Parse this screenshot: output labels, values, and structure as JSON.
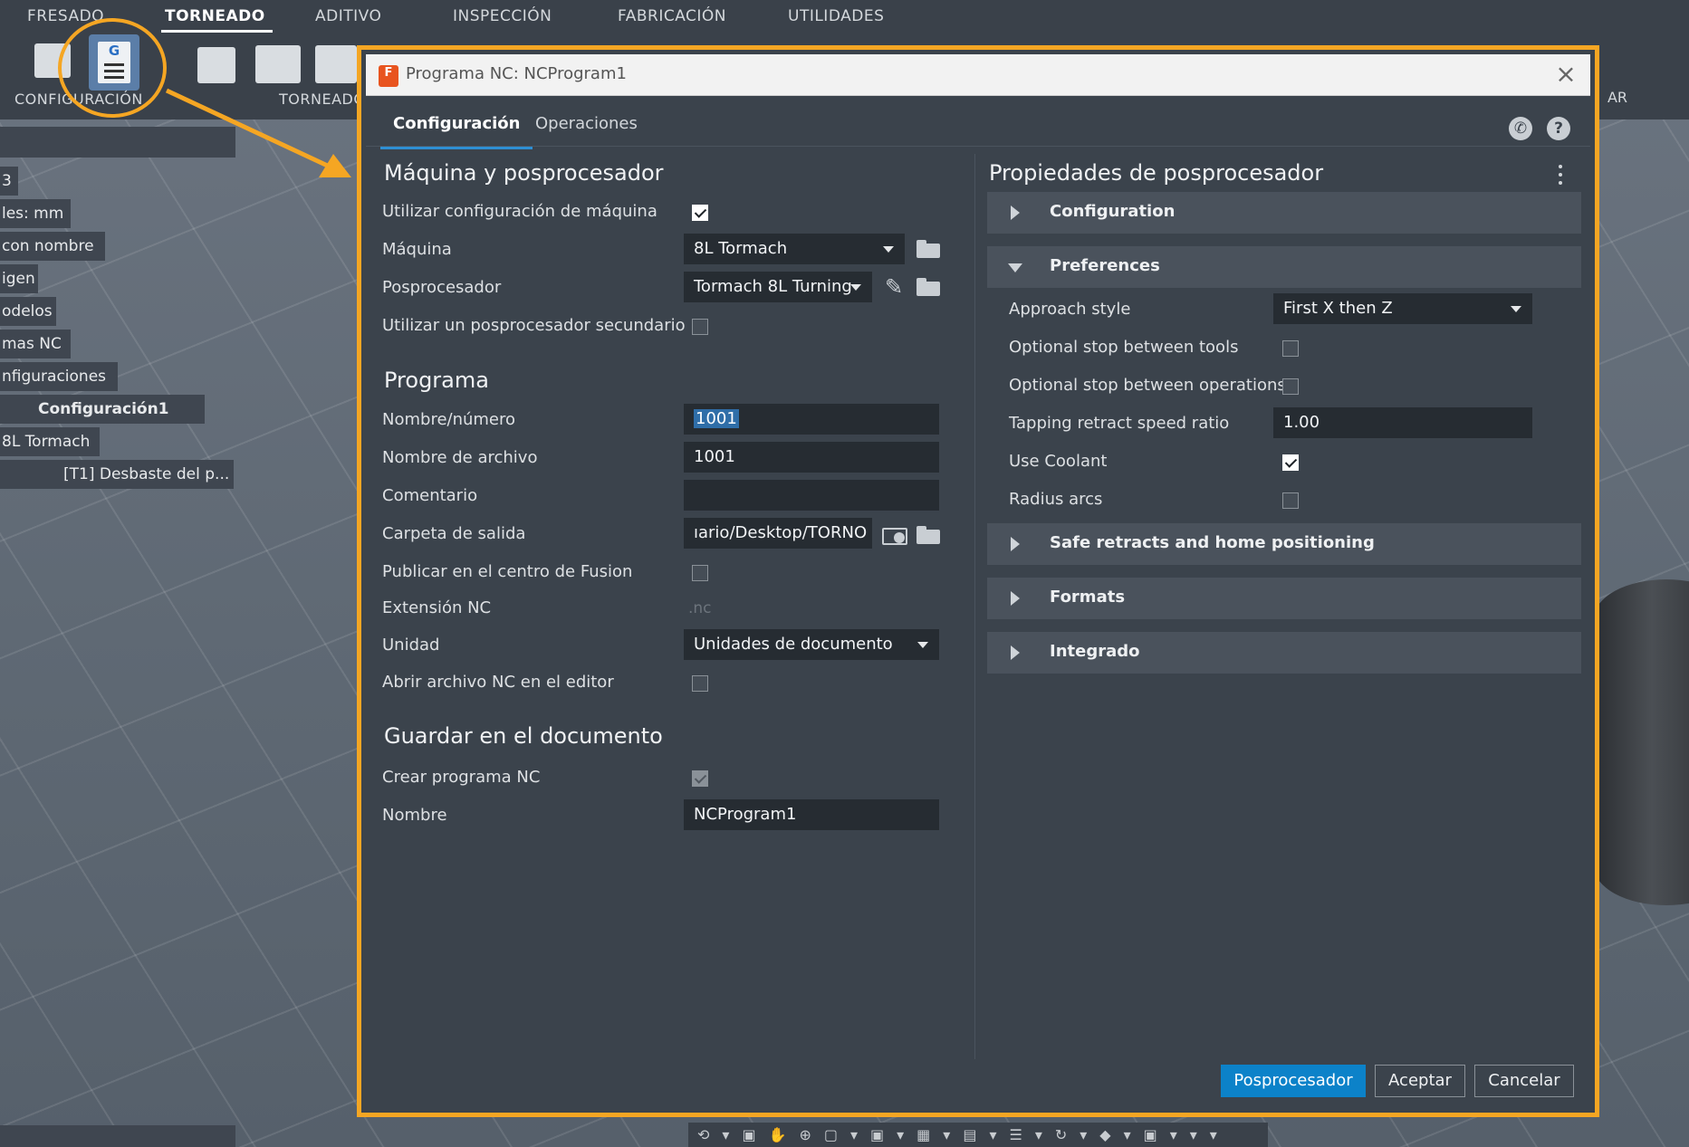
{
  "ribbon": {
    "tabs": [
      "FRESADO",
      "TORNEADO",
      "ADITIVO",
      "INSPECCIÓN",
      "FABRICACIÓN",
      "UTILIDADES"
    ],
    "active_tab": "TORNEADO",
    "group_labels": {
      "configuracion": "CONFIGURACIÓN",
      "torneado": "TORNEADO"
    },
    "right_peek": "AR"
  },
  "browser": {
    "items": [
      "3",
      "les: mm",
      "con nombre",
      "igen",
      "odelos",
      "mas NC",
      "nfiguraciones",
      "Configuración1",
      "8L Tormach",
      "[T1] Desbaste del p..."
    ]
  },
  "dialog": {
    "title": "Programa NC: NCProgram1",
    "tabs": [
      "Configuración",
      "Operaciones"
    ],
    "active_tab": "Configuración",
    "machine_section": {
      "title": "Máquina y posprocesador",
      "use_machine_config_label": "Utilizar configuración de máquina",
      "use_machine_config": true,
      "machine_label": "Máquina",
      "machine_value": "8L Tormach",
      "post_label": "Posprocesador",
      "post_value": "Tormach 8L Turning",
      "secondary_post_label": "Utilizar un posprocesador secundario",
      "secondary_post": false
    },
    "program_section": {
      "title": "Programa",
      "name_number_label": "Nombre/número",
      "name_number_value": "1001",
      "filename_label": "Nombre de archivo",
      "filename_value": "1001",
      "comment_label": "Comentario",
      "comment_value": "",
      "output_folder_label": "Carpeta de salida",
      "output_folder_value": "ıario/Desktop/TORNO",
      "publish_label": "Publicar en el centro de Fusion",
      "publish": false,
      "nc_ext_label": "Extensión NC",
      "nc_ext_value": ".nc",
      "unit_label": "Unidad",
      "unit_value": "Unidades de documento",
      "open_editor_label": "Abrir archivo NC en el editor",
      "open_editor": false
    },
    "save_section": {
      "title": "Guardar en el documento",
      "create_label": "Crear programa NC",
      "create": true,
      "name_label": "Nombre",
      "name_value": "NCProgram1"
    },
    "post_properties": {
      "title": "Propiedades de posprocesador",
      "groups": {
        "configuration": "Configuration",
        "preferences": "Preferences",
        "safe_retracts": "Safe retracts and home positioning",
        "formats": "Formats",
        "integrado": "Integrado"
      },
      "preferences": {
        "approach_style_label": "Approach style",
        "approach_style_value": "First X then Z",
        "opt_stop_tools_label": "Optional stop between tools",
        "opt_stop_tools": false,
        "opt_stop_ops_label": "Optional stop between operations",
        "opt_stop_ops": false,
        "tapping_ratio_label": "Tapping retract speed ratio",
        "tapping_ratio_value": "1.00",
        "use_coolant_label": "Use Coolant",
        "use_coolant": true,
        "radius_arcs_label": "Radius arcs",
        "radius_arcs": false
      }
    },
    "buttons": {
      "post": "Posprocesador",
      "ok": "Aceptar",
      "cancel": "Cancelar"
    }
  },
  "colors": {
    "accent_orange": "#f5a623",
    "primary_blue": "#0c82c9",
    "dialog_bg": "#3b434c"
  }
}
